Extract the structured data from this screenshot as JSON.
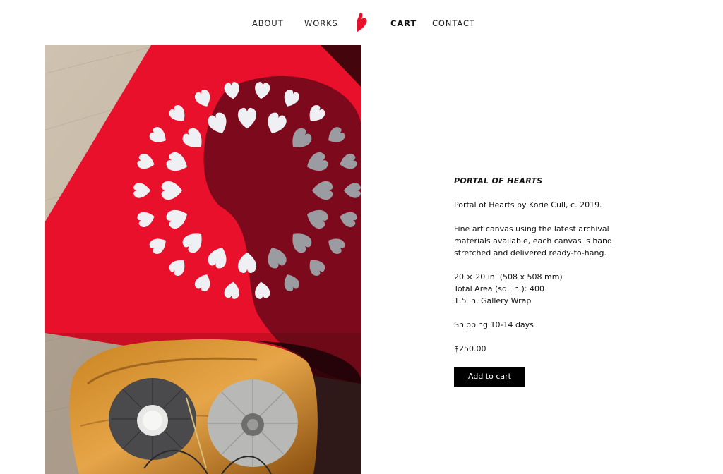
{
  "nav": {
    "about": "ABOUT",
    "works": "WORKS",
    "logo_icon": "red-heart-logo-icon",
    "cart": "CART",
    "contact": "CONTACT"
  },
  "product": {
    "title": "PORTAL OF HEARTS",
    "byline": "Portal of Hearts by Korie Cull, c. 2019.",
    "description": "Fine art canvas using the latest archival materials available, each canvas is hand stretched and delivered ready-to-hang.",
    "specs": [
      "20 × 20 in. (508 x 508 mm)",
      "Total Area (sq. in.): 400",
      "1.5 in. Gallery Wrap"
    ],
    "shipping": "Shipping 10-14 days",
    "price": "$250.00",
    "add_to_cart_label": "Add to cart"
  },
  "colors": {
    "accent_red": "#e8102a",
    "button_black": "#000000",
    "text": "#111111"
  }
}
